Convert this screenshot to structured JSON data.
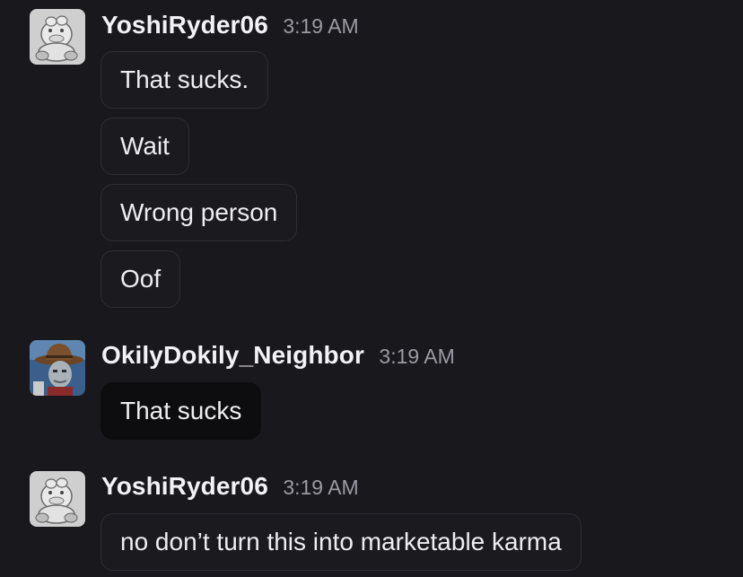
{
  "messages": [
    {
      "username": "YoshiRyder06",
      "time": "3:19 AM",
      "avatar": "yoshi-avatar",
      "lines": [
        "That sucks.",
        "Wait",
        "Wrong person",
        "Oof"
      ]
    },
    {
      "username": "OkilyDokily_Neighbor",
      "time": "3:19 AM",
      "avatar": "cowboy-avatar",
      "lines": [
        "That sucks"
      ]
    },
    {
      "username": "YoshiRyder06",
      "time": "3:19 AM",
      "avatar": "yoshi-avatar",
      "lines": [
        "no don’t turn this into marketable karma"
      ]
    }
  ],
  "colors": {
    "background": "#19181c",
    "bubble_border": "#2f2e35",
    "bubble_highlight": "#0d0d0f",
    "timestamp": "#9c9aa3"
  }
}
